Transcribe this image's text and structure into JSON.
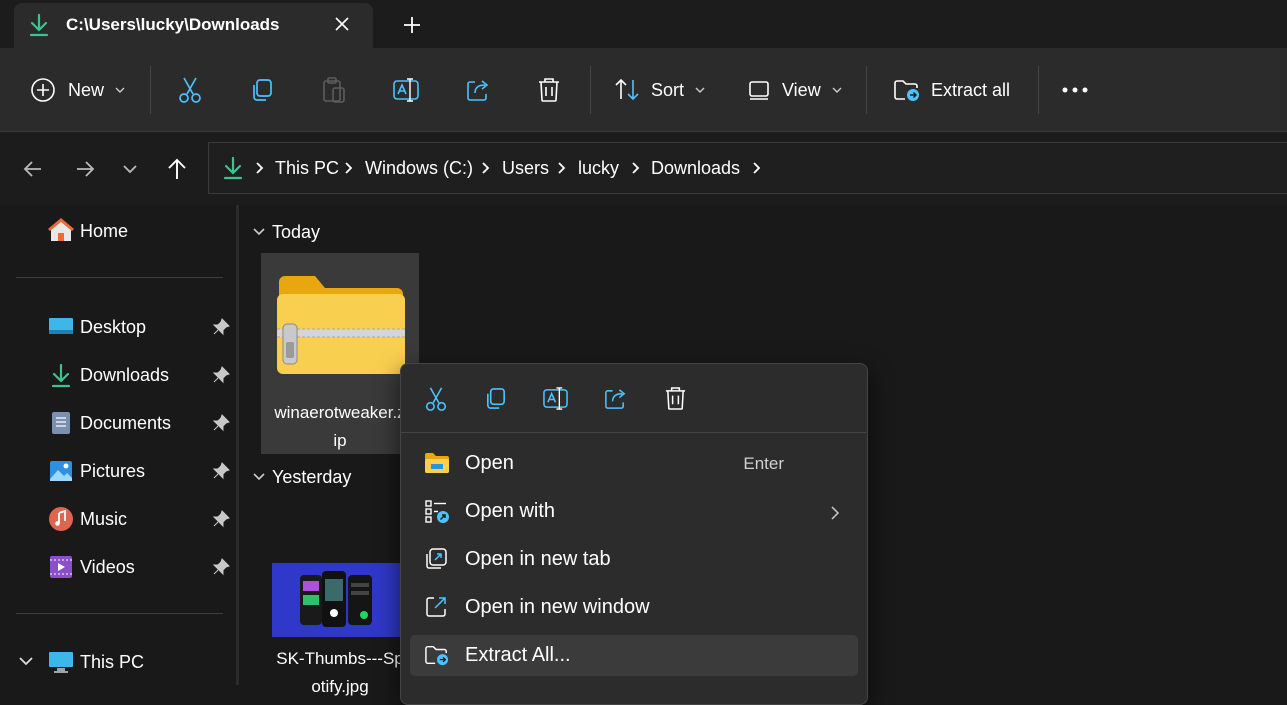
{
  "window": {
    "tab_title": "C:\\Users\\lucky\\Downloads"
  },
  "toolbar": {
    "new_label": "New",
    "sort_label": "Sort",
    "view_label": "View",
    "extract_label": "Extract all"
  },
  "breadcrumbs": [
    "This PC",
    "Windows (C:)",
    "Users",
    "lucky",
    "Downloads"
  ],
  "sidebar": {
    "home": "Home",
    "items": [
      "Desktop",
      "Downloads",
      "Documents",
      "Pictures",
      "Music",
      "Videos"
    ],
    "this_pc": "This PC"
  },
  "content": {
    "groups": [
      "Today",
      "Yesterday"
    ],
    "files": [
      {
        "name_line1": "winaerotweaker.z",
        "name_line2": "ip"
      },
      {
        "name_line1": "SK-Thumbs---Sp",
        "name_line2": "otify.jpg"
      }
    ]
  },
  "context_menu": {
    "items": [
      {
        "label": "Open",
        "shortcut": "Enter"
      },
      {
        "label": "Open with"
      },
      {
        "label": "Open in new tab"
      },
      {
        "label": "Open in new window"
      },
      {
        "label": "Extract All..."
      }
    ]
  },
  "colors": {
    "accent": "#4cc2ff",
    "download_green": "#3ec28f",
    "folder_yellow": "#f9cf4f"
  }
}
